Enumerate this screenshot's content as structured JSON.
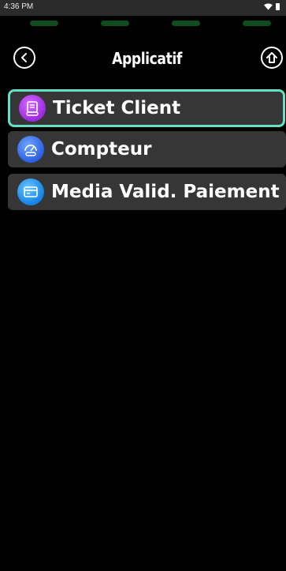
{
  "status_bar": {
    "time": "4:36 PM",
    "icons": [
      "wifi-icon",
      "battery-icon"
    ]
  },
  "header": {
    "title": "Applicatif",
    "back_icon": "chevron-left-circle-icon",
    "home_icon": "home-circle-icon"
  },
  "menu": {
    "items": [
      {
        "label": "Ticket Client",
        "icon": "receipt-icon",
        "selected": true
      },
      {
        "label": "Compteur",
        "icon": "gauge-icon",
        "selected": false
      },
      {
        "label": "Media Valid. Paiement",
        "icon": "card-icon",
        "selected": false
      }
    ]
  },
  "colors": {
    "selection_border": "#62e1c5",
    "item_background": "#363636",
    "status_pills": "#0f4d1f"
  }
}
